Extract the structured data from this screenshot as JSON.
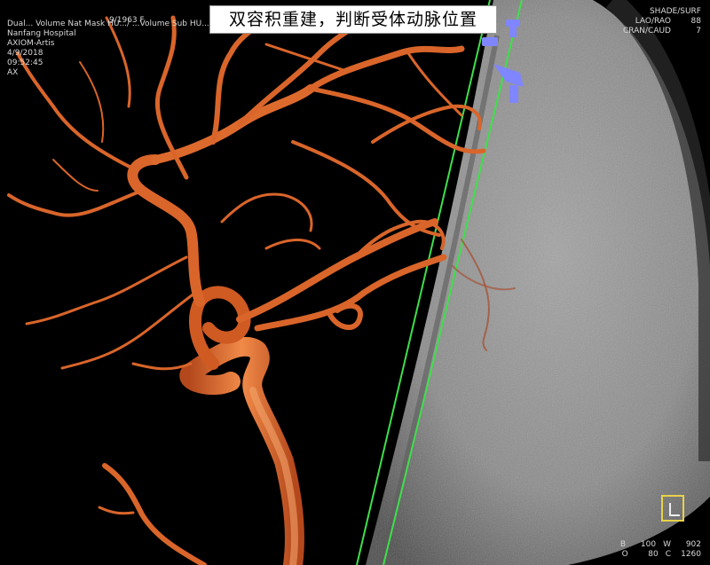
{
  "caption": "双容积重建，判断受体动脉位置",
  "overlay": {
    "patient_id": "9/1963 F",
    "series_line": "Dual... Volume Nat Mask HU.../ ...Volume Sub HU...",
    "hospital": "Nanfang Hospital",
    "device": "AXIOM-Artis",
    "date": "4/9/2018",
    "time": "09:52:45",
    "view": "AX",
    "render_mode": "SHADE/SURF",
    "lao_rao_label": "LAO/RAO",
    "lao_rao_value": "88",
    "cran_caud_label": "CRAN/CAUD",
    "cran_caud_value": "7",
    "b_label": "B",
    "b_value": "100",
    "w_label": "W",
    "w_value": "902",
    "o_label": "O",
    "o_value": "80",
    "c_label": "C",
    "c_value": "1260"
  },
  "colors": {
    "vessel": "#d9652a",
    "vessel_highlight": "#f4a46b",
    "guide_line": "#3ee04a",
    "marker": "#7f86ff",
    "skull": "#8c8c8c",
    "orientation_cube": "#e8d24a"
  }
}
